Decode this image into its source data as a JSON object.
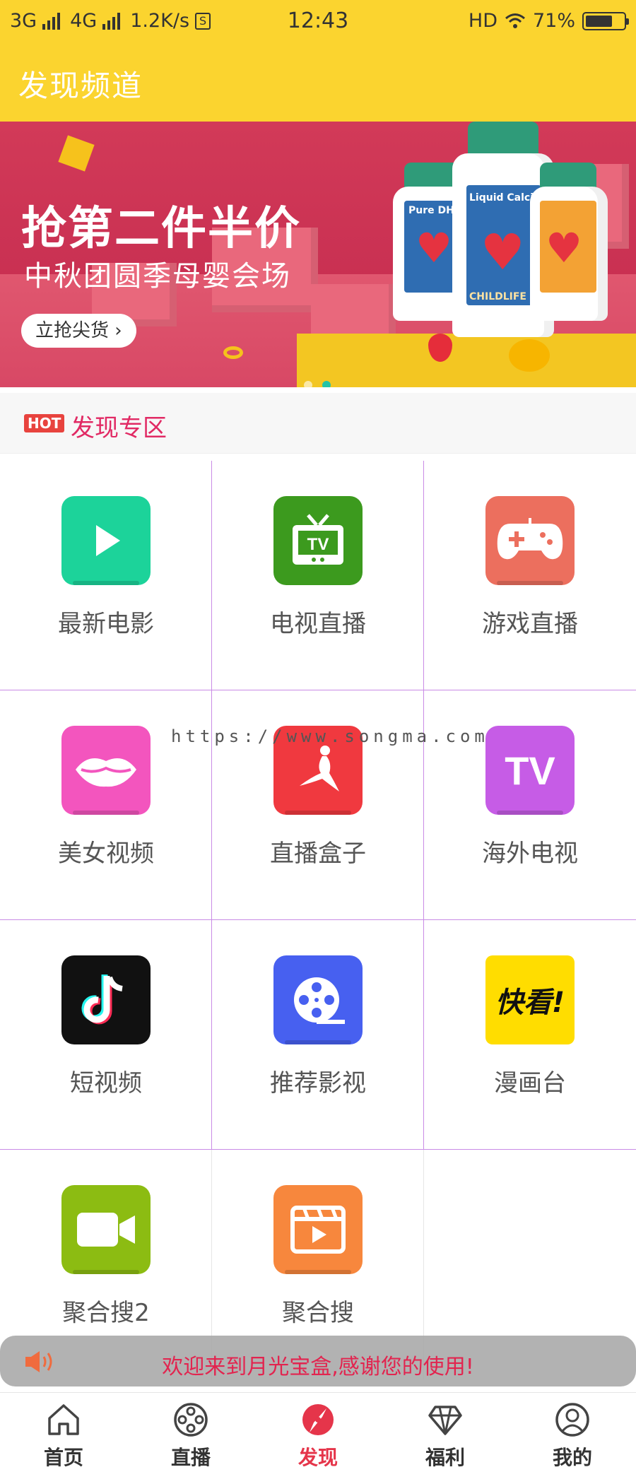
{
  "status_bar": {
    "network_1": "3G",
    "network_2": "4G",
    "speed": "1.2K/s",
    "time": "12:43",
    "hd": "HD",
    "battery": "71%",
    "battery_level": 0.71
  },
  "header": {
    "title": "发现频道"
  },
  "banner": {
    "headline": "抢第二件半价",
    "subline": "中秋团圆季母婴会场",
    "button_label": "立抢尖货",
    "button_arrow": "›",
    "product_1": "Pure DHA",
    "product_2": "Liquid Calcium",
    "brand": "CHILDLIFE",
    "slides_total": 2,
    "slide_active": 2
  },
  "section": {
    "badge": "HOT",
    "title": "发现专区"
  },
  "grid": {
    "items": [
      {
        "label": "最新电影",
        "icon": "play-icon",
        "color": "#1cd39a"
      },
      {
        "label": "电视直播",
        "icon": "tv-icon",
        "color": "#3c9a1e"
      },
      {
        "label": "游戏直播",
        "icon": "gamepad-icon",
        "color": "#ec6f5e"
      },
      {
        "label": "美女视频",
        "icon": "lips-icon",
        "color": "#f355be"
      },
      {
        "label": "直播盒子",
        "icon": "dancer-icon",
        "color": "#f0393f"
      },
      {
        "label": "海外电视",
        "icon": "tv-text-icon",
        "color": "#c65ce6",
        "icon_text": "TV"
      },
      {
        "label": "短视频",
        "icon": "tiktok-icon",
        "color": "#111111"
      },
      {
        "label": "推荐影视",
        "icon": "film-reel-icon",
        "color": "#4760f0"
      },
      {
        "label": "漫画台",
        "icon": "kuaikan-icon",
        "color": "#ffdd00",
        "icon_text": "快看!"
      },
      {
        "label": "聚合搜2",
        "icon": "video-camera-icon",
        "color": "#8cbc12"
      },
      {
        "label": "聚合搜",
        "icon": "clapperboard-icon",
        "color": "#f7873d"
      }
    ]
  },
  "watermark": "https://www.songma.com",
  "notice": {
    "text": "欢迎来到月光宝盒,感谢您的使用!"
  },
  "tabbar": {
    "tabs": [
      {
        "label": "首页",
        "icon": "home-icon"
      },
      {
        "label": "直播",
        "icon": "film-icon"
      },
      {
        "label": "发现",
        "icon": "discover-icon",
        "active": true
      },
      {
        "label": "福利",
        "icon": "diamond-icon"
      },
      {
        "label": "我的",
        "icon": "user-icon"
      }
    ]
  },
  "colors": {
    "header": "#fbd42f",
    "accent": "#e5354a",
    "grid_line": "#c98be6"
  }
}
